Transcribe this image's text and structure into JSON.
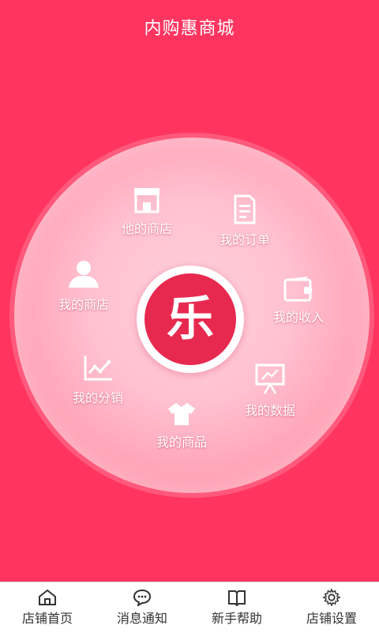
{
  "header": {
    "title": "内购惠商城"
  },
  "center": {
    "glyph": "乐"
  },
  "menu": {
    "other_store": "他的商店",
    "orders": "我的订单",
    "income": "我的收入",
    "data": "我的数据",
    "goods": "我的商品",
    "distribution": "我的分销",
    "my_store": "我的商店"
  },
  "icons": {
    "other_store": "storefront-icon",
    "orders": "document-icon",
    "income": "wallet-icon",
    "data": "presentation-chart-icon",
    "goods": "tshirt-icon",
    "distribution": "line-chart-icon",
    "my_store": "user-icon"
  },
  "tabbar": {
    "home": "店铺首页",
    "messages": "消息通知",
    "help": "新手帮助",
    "settings": "店铺设置"
  },
  "colors": {
    "background": "#ff3560",
    "logo": "#e8294f",
    "tab_text": "#333333"
  }
}
